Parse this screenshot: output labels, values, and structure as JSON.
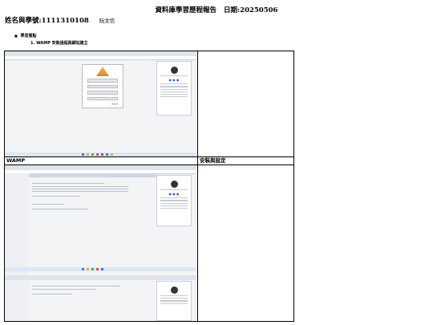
{
  "header": {
    "title": "資料庫學習歷程報告",
    "date": "日期:20250506"
  },
  "student": {
    "label": "姓名與學號:1111310108",
    "name": "阮文信"
  },
  "section": {
    "bullet": "■",
    "heading": "學習重點"
  },
  "item": {
    "text": "1.   WAMP 安裝過程與網站建立"
  },
  "table": {
    "row1_label": "WAMP",
    "row1_side": "安裝與設定"
  },
  "colors": {
    "page": "#ffffff",
    "screen_bg": "#f3f4f6",
    "taskbar": "#dde6f2"
  }
}
